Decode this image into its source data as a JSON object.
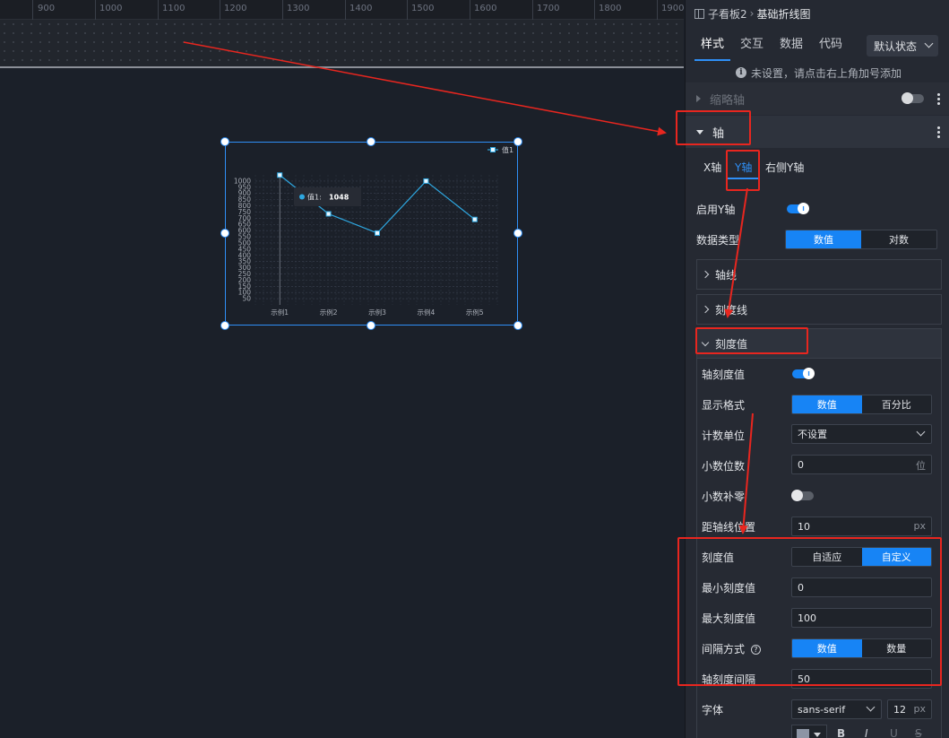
{
  "ruler": {
    "ticks": [
      "900",
      "1000",
      "1100",
      "1200",
      "1300",
      "1400",
      "1500",
      "1600",
      "1700",
      "1800",
      "1900"
    ]
  },
  "chart": {
    "legend": "值1",
    "tooltip": {
      "series": "值1:",
      "value": "1048"
    }
  },
  "chart_data": {
    "type": "line",
    "categories": [
      "示例1",
      "示例2",
      "示例3",
      "示例4",
      "示例5"
    ],
    "series": [
      {
        "name": "值1",
        "values": [
          1048,
          735,
          580,
          1000,
          690
        ]
      }
    ],
    "yticks": [
      "1000",
      "950",
      "900",
      "850",
      "800",
      "750",
      "700",
      "650",
      "600",
      "550",
      "500",
      "450",
      "400",
      "350",
      "300",
      "250",
      "200",
      "150",
      "100",
      "50"
    ],
    "ylim": [
      0,
      1050
    ],
    "grid": true,
    "legend_position": "top-right",
    "colors": [
      "#2ea7e0"
    ]
  },
  "panel": {
    "breadcrumb": {
      "parent": "子看板2",
      "sep": "›",
      "current": "基础折线图"
    },
    "tabs": [
      "样式",
      "交互",
      "数据",
      "代码"
    ],
    "state_select": "默认状态",
    "hint": "未设置，请点击右上角加号添加",
    "section_zoom": "缩略轴",
    "section_axis": "轴",
    "axis_tabs": [
      "X轴",
      "Y轴",
      "右侧Y轴"
    ],
    "enable_y_label": "启用Y轴",
    "data_type_label": "数据类型",
    "data_type_options": [
      "数值",
      "对数"
    ],
    "axis_line": "轴线",
    "tick_line": "刻度线",
    "tick_value": "刻度值",
    "axis_tick_value_label": "轴刻度值",
    "display_format_label": "显示格式",
    "display_format_options": [
      "数值",
      "百分比"
    ],
    "count_unit_label": "计数单位",
    "count_unit_value": "不设置",
    "decimals_label": "小数位数",
    "decimals_value": "0",
    "decimals_unit": "位",
    "decimal_pad_label": "小数补零",
    "offset_label": "距轴线位置",
    "offset_value": "10",
    "offset_unit": "px",
    "tick_mode_label": "刻度值",
    "tick_mode_options": [
      "自适应",
      "自定义"
    ],
    "min_tick_label": "最小刻度值",
    "min_tick_value": "0",
    "max_tick_label": "最大刻度值",
    "max_tick_value": "100",
    "interval_label": "间隔方式",
    "interval_options": [
      "数值",
      "数量"
    ],
    "tick_interval_label": "轴刻度间隔",
    "tick_interval_value": "50",
    "font_label": "字体",
    "font_value": "sans-serif",
    "font_size_value": "12",
    "font_size_unit": "px",
    "format_buttons": [
      "B",
      "I",
      "U",
      "S"
    ]
  },
  "colors": {
    "accent": "#1784f5",
    "annotation": "#e8261f",
    "line": "#2ea7e0"
  }
}
